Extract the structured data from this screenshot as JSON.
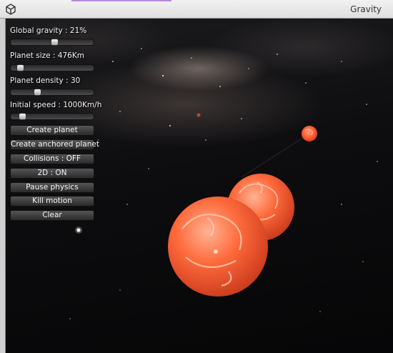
{
  "window": {
    "title": "Gravity",
    "accent_color": "#b78bd8"
  },
  "controls": {
    "global_gravity": {
      "label": "Global gravity : 21%",
      "value_fraction": 0.53
    },
    "planet_size": {
      "label": "Planet size : 476Km",
      "value_fraction": 0.08
    },
    "planet_density": {
      "label": "Planet density : 30",
      "value_fraction": 0.3
    },
    "initial_speed": {
      "label": "Initial speed : 1000Km/h",
      "value_fraction": 0.1
    }
  },
  "buttons": {
    "create_planet": "Create planet",
    "create_anchored_planet": "Create anchored planet",
    "collisions": "Collisions : OFF",
    "mode_2d": "2D : ON",
    "pause_physics": "Pause physics",
    "kill_motion": "Kill motion",
    "clear": "Clear"
  },
  "scene": {
    "planet_color": "#ff6a3c",
    "planet_highlight": "#ffd2bf",
    "space_color": "#050506"
  }
}
